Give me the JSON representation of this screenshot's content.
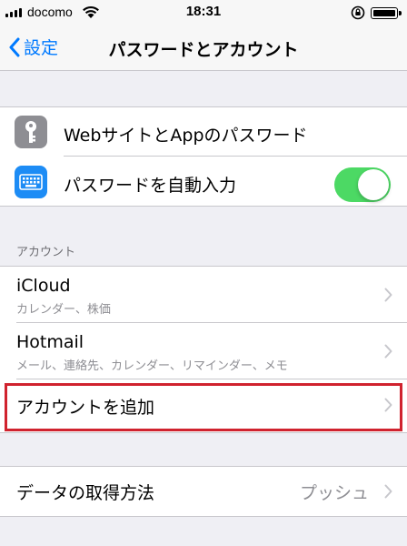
{
  "status_bar": {
    "carrier": "docomo",
    "time": "18:31"
  },
  "nav": {
    "back_label": "設定",
    "title": "パスワードとアカウント"
  },
  "passwords_group": {
    "items": [
      {
        "label": "WebサイトとAppのパスワード",
        "icon": "key-icon"
      },
      {
        "label": "パスワードを自動入力",
        "icon": "keyboard-icon",
        "toggle_on": true
      }
    ]
  },
  "accounts_group": {
    "header": "アカウント",
    "accounts": [
      {
        "name": "iCloud",
        "detail": "カレンダー、株価"
      },
      {
        "name": "Hotmail",
        "detail": "メール、連絡先、カレンダー、リマインダー、メモ"
      }
    ],
    "add_account_label": "アカウントを追加"
  },
  "fetch_group": {
    "label": "データの取得方法",
    "value": "プッシュ"
  },
  "colors": {
    "accent": "#007aff",
    "toggle_on": "#4cd964",
    "highlight_frame": "#d0222e",
    "background": "#efeff4"
  }
}
